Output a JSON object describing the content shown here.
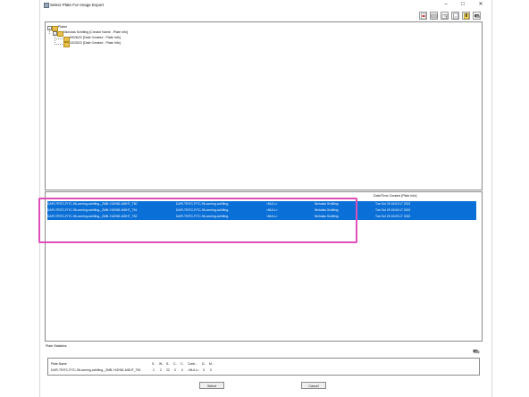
{
  "window": {
    "title": "Select Plate For Image Export"
  },
  "toolbar_icons": [
    "export-icon",
    "plate-icon",
    "folder-open-icon",
    "document-icon",
    "bookmark-icon",
    "chat-icon"
  ],
  "tree": {
    "root": "Plates",
    "creator": "Nicholas Schilling [Creator Name - Plate Info]",
    "children": [
      "09/26/22 [Date Created - Plate Info]",
      "10/25/22 [Date Created - Plate Info]"
    ]
  },
  "table": {
    "date_header": "Date/Time Created [Plate Info]",
    "rows": [
      {
        "plate": "DAPI-TRITC-FITC-96-corning-schilling-_ZMB-Y4ZH81-MDHT_T50",
        "assay": "DAPI-TRITC-FITC-96-corning-schilling-",
        "status": "<NULL>",
        "creator": "Nicholas Schilling",
        "created": "Tue Oct 25 15:03:17 2022"
      },
      {
        "plate": "DAPI-TRITC-FITC-96-corning-schilling-_ZMB-Y4ZH81-MDHT_T51",
        "assay": "DAPI-TRITC-FITC-96-corning-schilling-",
        "status": "<NULL>",
        "creator": "Nicholas Schilling",
        "created": "Tue Oct 25 15:06:17 2022"
      },
      {
        "plate": "DAPI-TRITC-FITC-96-corning-schilling-_ZMB-Y4ZH81-MDHT_T52",
        "assay": "DAPI-TRITC-FITC-96-corning-schilling-",
        "status": "<NULL>",
        "creator": "Nicholas Schilling",
        "created": "Tue Oct 25 15:09:17 2022"
      }
    ]
  },
  "stats": {
    "label": "Plate Statistics",
    "headers": [
      "Plate Name",
      "S..",
      "W..",
      "S..",
      "C..",
      "C..",
      "Contr...",
      "D..",
      "M.."
    ],
    "row": [
      "DAPI-TRITC-FITC-96-corning-schilling-_ZMB-Y4ZH81-MDHT_T50",
      "2",
      "2",
      "22",
      "0",
      "0",
      "<NULL>",
      "0",
      "0"
    ]
  },
  "buttons": {
    "select": "Select",
    "cancel": "Cancel"
  },
  "colors": {
    "selection": "#0a6fd6",
    "highlight": "#e04fb9"
  }
}
